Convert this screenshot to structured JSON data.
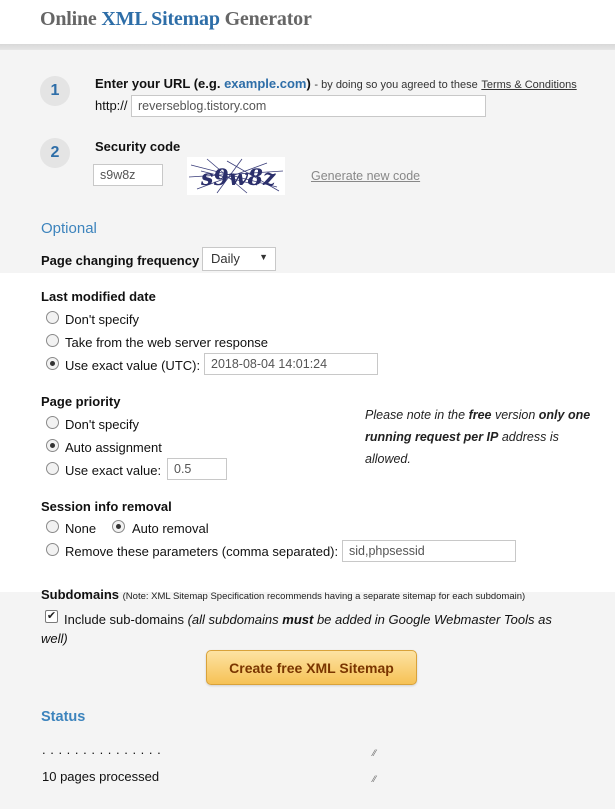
{
  "header": {
    "title_prefix": "Online",
    "title_highlight": "XML Sitemap",
    "title_suffix": "Generator"
  },
  "step1": {
    "number": "1",
    "label": "Enter your URL (e.g.",
    "example": "example.com",
    "label_close": ")",
    "agree_text": "- by doing so you agreed to these",
    "terms_link": "Terms & Conditions",
    "prefix": "http://",
    "url_value": "reverseblog.tistory.com"
  },
  "step2": {
    "number": "2",
    "label": "Security code",
    "code_value": "s9w8z",
    "captcha_text": "s9w8z",
    "generate_link": "Generate new code"
  },
  "optional": {
    "title": "Optional",
    "frequency_label": "Page changing frequency",
    "frequency_value": "Daily"
  },
  "last_modified": {
    "title": "Last modified date",
    "options": [
      "Don't specify",
      "Take from the web server response",
      "Use exact value (UTC):"
    ],
    "selected_index": 2,
    "exact_value": "2018-08-04 14:01:24"
  },
  "priority": {
    "title": "Page priority",
    "options": [
      "Don't specify",
      "Auto assignment",
      "Use exact value:"
    ],
    "selected_index": 1,
    "exact_value": "0.5",
    "note_1": "Please note in the",
    "note_free": "free",
    "note_2": "version",
    "note_only": "only",
    "note_one": "one running request per IP",
    "note_3": "address",
    "note_4": "is allowed."
  },
  "session": {
    "title": "Session info removal",
    "option_none": "None",
    "option_auto": "Auto removal",
    "selected": "Auto removal",
    "option_remove": "Remove these parameters (comma separated):",
    "params_value": "sid,phpsessid"
  },
  "subdomains": {
    "title": "Subdomains",
    "note": "(Note: XML Sitemap Specification recommends having a separate sitemap for each subdomain)",
    "checked": true,
    "check_label": "Include sub-domains",
    "check_detail_1": "(all subdomains",
    "check_detail_must": "must",
    "check_detail_2": "be added in Google Webmaster Tools as",
    "check_detail_3": "well)"
  },
  "actions": {
    "create_button": "Create free XML Sitemap"
  },
  "status": {
    "title": "Status",
    "dots": ". . . . . . . . . . . . . . .",
    "processed": "10 pages processed"
  },
  "colors": {
    "accent": "#2e6ea8",
    "section": "#3d84bd",
    "button_top": "#fde3a3",
    "button_bottom": "#f6c255",
    "button_text": "#7a3500"
  }
}
